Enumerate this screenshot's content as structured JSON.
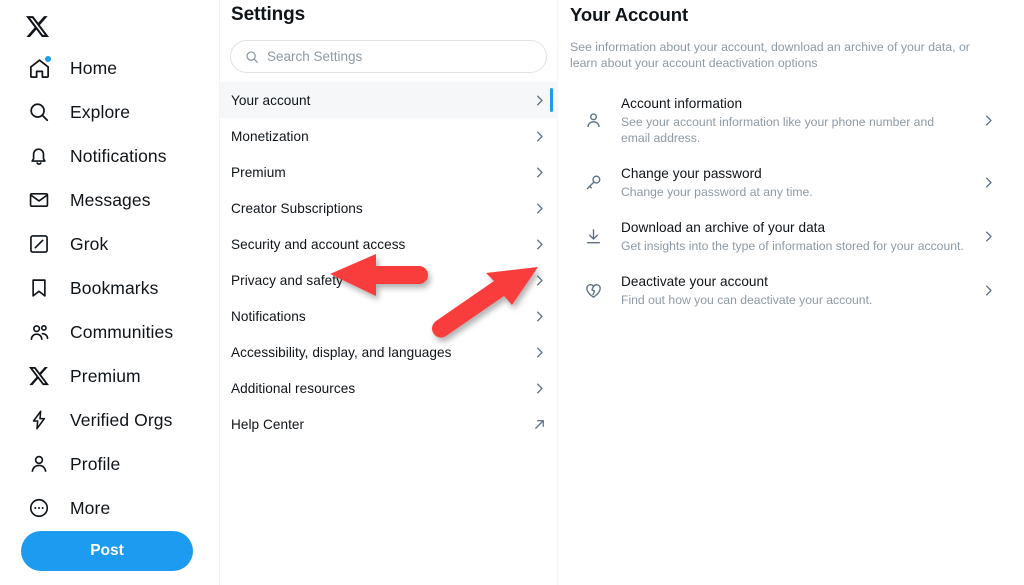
{
  "colors": {
    "brand_blue": "#1d9bf0",
    "annotation_red": "#f93e3e",
    "text_primary": "#0f1419",
    "text_secondary": "#8e9aa3",
    "selected_row_bg": "#f5f7f8"
  },
  "sidebar": {
    "logo": "x-logo",
    "post_label": "Post",
    "items": [
      {
        "label": "Home",
        "icon": "home-icon",
        "badge": true
      },
      {
        "label": "Explore",
        "icon": "search-icon",
        "badge": false
      },
      {
        "label": "Notifications",
        "icon": "bell-icon",
        "badge": false
      },
      {
        "label": "Messages",
        "icon": "envelope-icon",
        "badge": false
      },
      {
        "label": "Grok",
        "icon": "grok-icon",
        "badge": false
      },
      {
        "label": "Bookmarks",
        "icon": "bookmark-icon",
        "badge": false
      },
      {
        "label": "Communities",
        "icon": "communities-icon",
        "badge": false
      },
      {
        "label": "Premium",
        "icon": "x-logo-icon",
        "badge": false
      },
      {
        "label": "Verified Orgs",
        "icon": "lightning-badge-icon",
        "badge": false
      },
      {
        "label": "Profile",
        "icon": "person-icon",
        "badge": false
      },
      {
        "label": "More",
        "icon": "more-circle-icon",
        "badge": false
      }
    ]
  },
  "settings": {
    "title": "Settings",
    "search": {
      "placeholder": "Search Settings",
      "value": "",
      "icon": "search-icon"
    },
    "items": [
      {
        "label": "Your account",
        "selected": true,
        "trailing": "chevron-right-icon"
      },
      {
        "label": "Monetization",
        "selected": false,
        "trailing": "chevron-right-icon"
      },
      {
        "label": "Premium",
        "selected": false,
        "trailing": "chevron-right-icon"
      },
      {
        "label": "Creator Subscriptions",
        "selected": false,
        "trailing": "chevron-right-icon"
      },
      {
        "label": "Security and account access",
        "selected": false,
        "trailing": "chevron-right-icon"
      },
      {
        "label": "Privacy and safety",
        "selected": false,
        "trailing": "chevron-right-icon"
      },
      {
        "label": "Notifications",
        "selected": false,
        "trailing": "chevron-right-icon"
      },
      {
        "label": "Accessibility, display, and languages",
        "selected": false,
        "trailing": "chevron-right-icon"
      },
      {
        "label": "Additional resources",
        "selected": false,
        "trailing": "chevron-right-icon"
      },
      {
        "label": "Help Center",
        "selected": false,
        "trailing": "external-link-icon"
      }
    ]
  },
  "detail": {
    "title": "Your Account",
    "description": "See information about your account, download an archive of your data, or learn about your account deactivation options",
    "rows": [
      {
        "title": "Account information",
        "subtitle": "See your account information like your phone number and email address.",
        "icon": "person-icon"
      },
      {
        "title": "Change your password",
        "subtitle": "Change your password at any time.",
        "icon": "key-icon"
      },
      {
        "title": "Download an archive of your data",
        "subtitle": "Get insights into the type of information stored for your account.",
        "icon": "download-icon"
      },
      {
        "title": "Deactivate your account",
        "subtitle": "Find out how you can deactivate your account.",
        "icon": "broken-heart-icon"
      }
    ]
  },
  "annotations": [
    {
      "name": "arrow-pointing-to-privacy-and-safety-label",
      "direction": "left"
    },
    {
      "name": "arrow-pointing-to-privacy-and-safety-chevron",
      "direction": "up-right"
    }
  ]
}
